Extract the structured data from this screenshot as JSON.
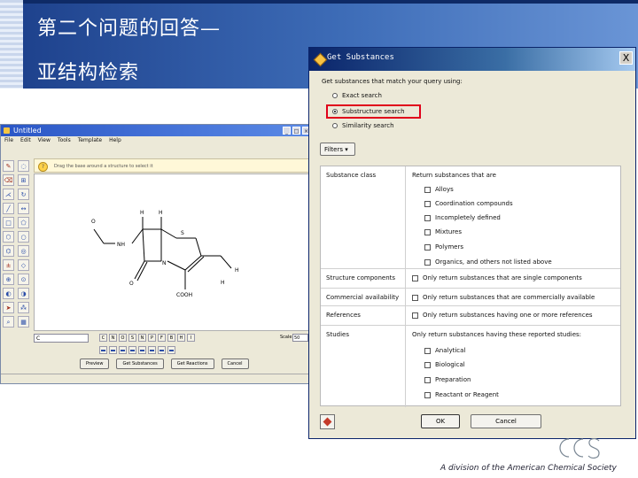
{
  "slide": {
    "title_line1": "第二个问题的回答—",
    "title_line2": "亚结构检索",
    "footer": "A division of the American Chemical Society"
  },
  "editor": {
    "window_title": "Untitled",
    "menu": [
      "File",
      "Edit",
      "View",
      "Tools",
      "Template",
      "Help"
    ],
    "hint": "Drag the base around a structure to select it",
    "element_value": "C",
    "atom_buttons": [
      "C",
      "N",
      "O",
      "S",
      "N",
      "P",
      "F",
      "B",
      "H",
      "I"
    ],
    "scale_label": "Scale:",
    "scale_value": "50",
    "buttons": [
      "Preview",
      "Get Substances",
      "Get Reactions",
      "Cancel"
    ],
    "structure_labels": {
      "o1": "O",
      "nh": "NH",
      "h1": "H",
      "h2": "H",
      "s": "S",
      "n": "N",
      "o2": "O",
      "h3": "H",
      "h4": "H",
      "cooh": "COOH"
    }
  },
  "dialog": {
    "title": "Get Substances",
    "close": "X",
    "prompt": "Get substances that match your query using:",
    "search_options": [
      {
        "label": "Exact search",
        "selected": false
      },
      {
        "label": "Substructure search",
        "selected": true
      },
      {
        "label": "Similarity search",
        "selected": false
      }
    ],
    "filters_label": "Filters ▾",
    "filter_rows": [
      {
        "label": "Substance class",
        "heading": "Return substances that are",
        "options": [
          "Alloys",
          "Coordination compounds",
          "Incompletely defined",
          "Mixtures",
          "Polymers",
          "Organics, and others not listed above"
        ]
      },
      {
        "label": "Structure components",
        "options": [
          "Only return substances that are single components"
        ]
      },
      {
        "label": "Commercial availability",
        "options": [
          "Only return substances that are commercially available"
        ]
      },
      {
        "label": "References",
        "options": [
          "Only return substances having one or more references"
        ]
      },
      {
        "label": "Studies",
        "heading": "Only return substances having these reported studies:",
        "options": [
          "Analytical",
          "Biological",
          "Preparation",
          "Reactant or Reagent"
        ]
      }
    ],
    "ok": "OK",
    "cancel": "Cancel"
  },
  "colors": {
    "title_band": "#1c3f8a",
    "highlight": "#e0001a",
    "dialog_titlebar": "#0a246a"
  }
}
